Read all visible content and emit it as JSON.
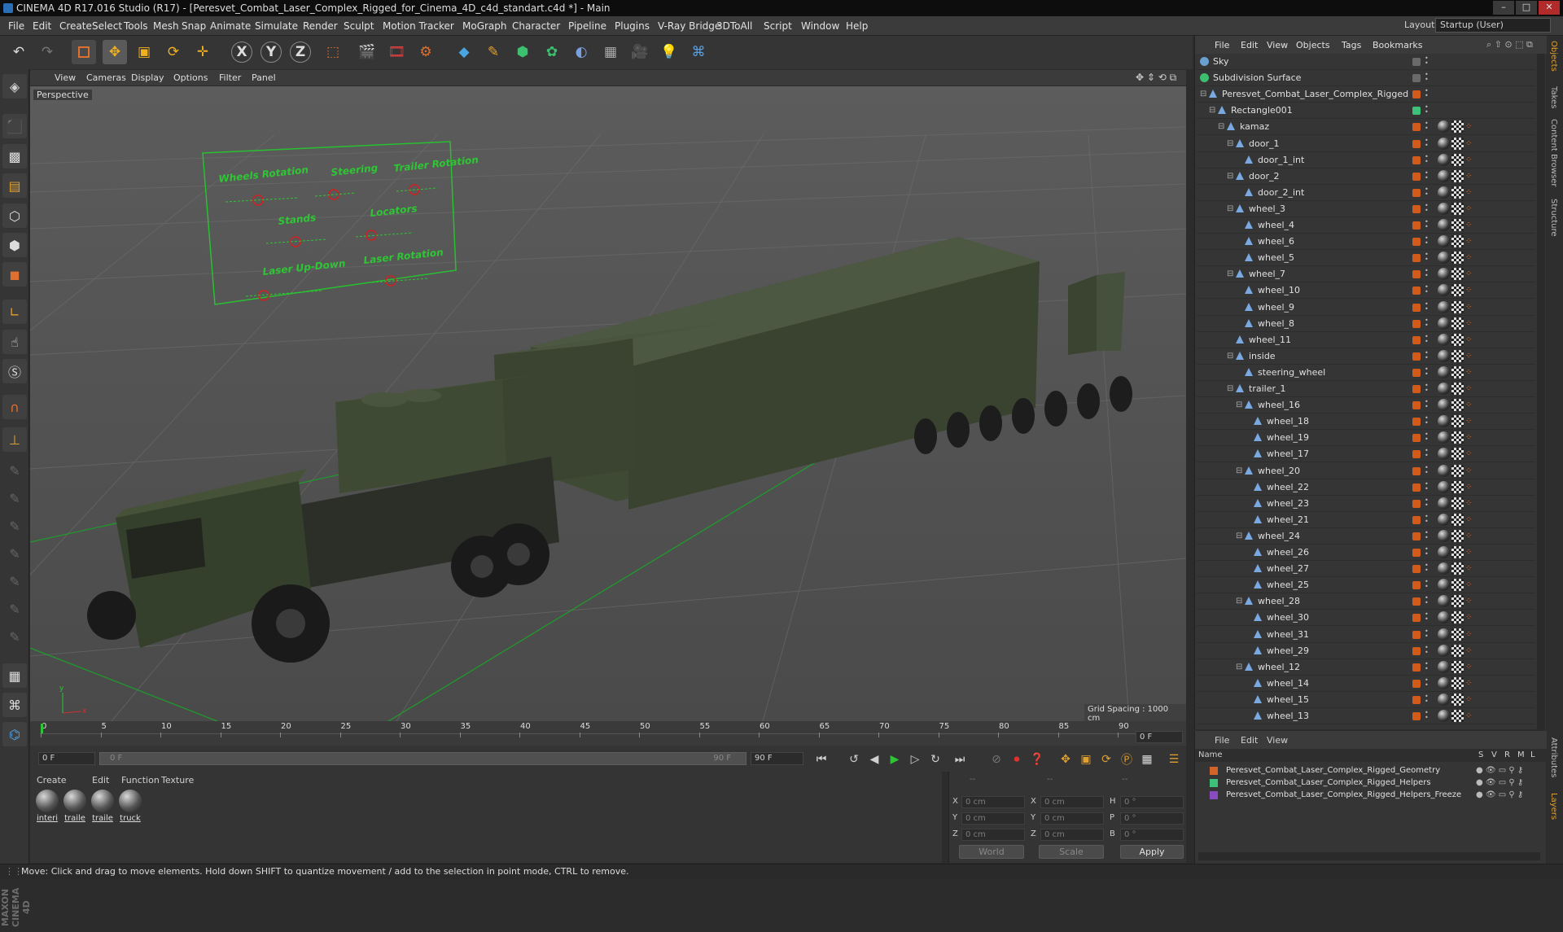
{
  "window": {
    "title": "CINEMA 4D R17.016 Studio (R17) - [Peresvet_Combat_Laser_Complex_Rigged_for_Cinema_4D_c4d_standart.c4d *] - Main"
  },
  "menubar": {
    "items": [
      "File",
      "Edit",
      "Create",
      "Select",
      "Tools",
      "Mesh",
      "Snap",
      "Animate",
      "Simulate",
      "Render",
      "Sculpt",
      "Motion Tracker",
      "MoGraph",
      "Character",
      "Pipeline",
      "Plugins",
      "V-Ray Bridge",
      "3DToAll",
      "Script",
      "Window",
      "Help"
    ],
    "layout_label": "Layout:",
    "layout_value": "Startup (User)"
  },
  "viewport": {
    "menu": [
      "View",
      "Cameras",
      "Display",
      "Options",
      "Filter",
      "Panel"
    ],
    "camera_label": "Perspective",
    "grid_spacing": "Grid Spacing : 1000 cm",
    "control_panel": {
      "labels": [
        "Wheels Rotation",
        "Steering",
        "Trailer Rotation",
        "Stands",
        "Locators",
        "Laser Up-Down",
        "Laser Rotation"
      ]
    }
  },
  "timeline": {
    "ticks": [
      "0",
      "5",
      "10",
      "15",
      "20",
      "25",
      "30",
      "35",
      "40",
      "45",
      "50",
      "55",
      "60",
      "65",
      "70",
      "75",
      "80",
      "85",
      "90"
    ],
    "end_frame_field": "0 F",
    "start_field": "0 F",
    "range_start": "0 F",
    "range_end": "90 F",
    "end_field": "90 F"
  },
  "material_manager": {
    "menu": [
      "Create",
      "Edit",
      "Function",
      "Texture"
    ],
    "materials": [
      "interi",
      "traile",
      "traile",
      "truck"
    ]
  },
  "coordinates": {
    "header_left": "--",
    "header_mid": "--",
    "header_right": "--",
    "rows": [
      {
        "a": "X",
        "av": "0 cm",
        "b": "X",
        "bv": "0 cm",
        "c": "H",
        "cv": "0 °"
      },
      {
        "a": "Y",
        "av": "0 cm",
        "b": "Y",
        "bv": "0 cm",
        "c": "P",
        "cv": "0 °"
      },
      {
        "a": "Z",
        "av": "0 cm",
        "b": "Z",
        "bv": "0 cm",
        "c": "B",
        "cv": "0 °"
      }
    ],
    "mode_world": "World",
    "mode_scale": "Scale",
    "apply": "Apply"
  },
  "object_manager": {
    "menu": [
      "File",
      "Edit",
      "View",
      "Objects",
      "Tags",
      "Bookmarks"
    ],
    "objects": [
      {
        "name": "Sky",
        "depth": 0
      },
      {
        "name": "Subdivision Surface",
        "depth": 0
      },
      {
        "name": "Peresvet_Combat_Laser_Complex_Rigged",
        "depth": 1
      },
      {
        "name": "Rectangle001",
        "depth": 2
      },
      {
        "name": "kamaz",
        "depth": 3
      },
      {
        "name": "door_1",
        "depth": 4
      },
      {
        "name": "door_1_int",
        "depth": 5
      },
      {
        "name": "door_2",
        "depth": 4
      },
      {
        "name": "door_2_int",
        "depth": 5
      },
      {
        "name": "wheel_3",
        "depth": 4
      },
      {
        "name": "wheel_4",
        "depth": 5
      },
      {
        "name": "wheel_6",
        "depth": 5
      },
      {
        "name": "wheel_5",
        "depth": 5
      },
      {
        "name": "wheel_7",
        "depth": 4
      },
      {
        "name": "wheel_10",
        "depth": 5
      },
      {
        "name": "wheel_9",
        "depth": 5
      },
      {
        "name": "wheel_8",
        "depth": 5
      },
      {
        "name": "wheel_11",
        "depth": 4
      },
      {
        "name": "inside",
        "depth": 4
      },
      {
        "name": "steering_wheel",
        "depth": 5
      },
      {
        "name": "trailer_1",
        "depth": 4
      },
      {
        "name": "wheel_16",
        "depth": 5
      },
      {
        "name": "wheel_18",
        "depth": 6
      },
      {
        "name": "wheel_19",
        "depth": 6
      },
      {
        "name": "wheel_17",
        "depth": 6
      },
      {
        "name": "wheel_20",
        "depth": 5
      },
      {
        "name": "wheel_22",
        "depth": 6
      },
      {
        "name": "wheel_23",
        "depth": 6
      },
      {
        "name": "wheel_21",
        "depth": 6
      },
      {
        "name": "wheel_24",
        "depth": 5
      },
      {
        "name": "wheel_26",
        "depth": 6
      },
      {
        "name": "wheel_27",
        "depth": 6
      },
      {
        "name": "wheel_25",
        "depth": 6
      },
      {
        "name": "wheel_28",
        "depth": 5
      },
      {
        "name": "wheel_30",
        "depth": 6
      },
      {
        "name": "wheel_31",
        "depth": 6
      },
      {
        "name": "wheel_29",
        "depth": 6
      },
      {
        "name": "wheel_12",
        "depth": 5
      },
      {
        "name": "wheel_14",
        "depth": 6
      },
      {
        "name": "wheel_15",
        "depth": 6
      },
      {
        "name": "wheel_13",
        "depth": 6
      }
    ]
  },
  "layer_manager": {
    "menu": [
      "File",
      "Edit",
      "View"
    ],
    "header": {
      "name": "Name",
      "cols": [
        "S",
        "V",
        "R",
        "M",
        "L"
      ]
    },
    "layers": [
      {
        "name": "Peresvet_Combat_Laser_Complex_Rigged_Geometry",
        "color": "#d2642a"
      },
      {
        "name": "Peresvet_Combat_Laser_Complex_Rigged_Helpers",
        "color": "#3cc07a"
      },
      {
        "name": "Peresvet_Combat_Laser_Complex_Rigged_Helpers_Freeze",
        "color": "#8a4ac0"
      }
    ]
  },
  "right_tabs": [
    "Objects",
    "Takes",
    "Content Browser",
    "Structure",
    "Attributes",
    "Layers"
  ],
  "statusbar": {
    "text": "Move: Click and drag to move elements. Hold down SHIFT to quantize movement / add to the selection in point mode, CTRL to remove."
  }
}
